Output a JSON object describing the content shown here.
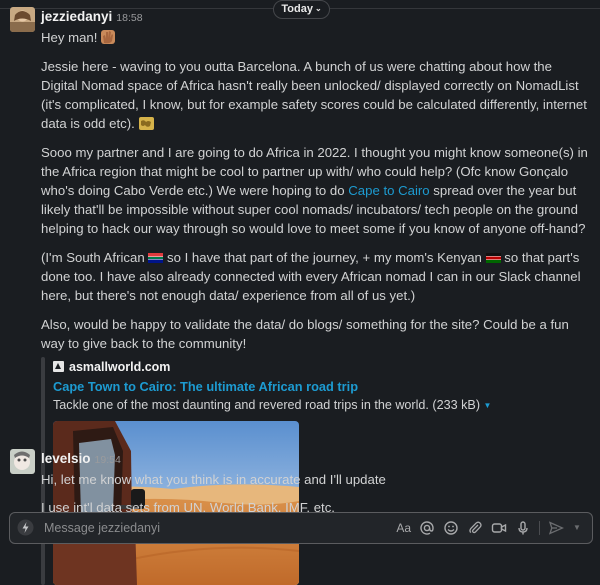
{
  "day_divider": {
    "label": "Today",
    "chevron": "chevron-down-icon"
  },
  "messages": [
    {
      "author": "jezziedanyi",
      "time": "18:58",
      "greeting": "Hey man!",
      "p1": "Jessie here - waving to you outta Barcelona. A bunch of us were chatting about how the Digital Nomad space of Africa hasn't really been unlocked/ displayed correctly on NomadList (it's complicated, I know, but for example safety scores could be calculated differently, internet data is odd etc).",
      "p2_a": "Sooo my partner and I are going to do Africa in 2022. I thought you might know someone(s) in the Africa region that might be cool to partner up with/ who could help? (Ofc know Gonçalo who's doing Cabo Verde etc.) We were hoping to do ",
      "p2_link": "Cape to Cairo",
      "p2_b": " spread over the year but likely that'll be impossible without super cool nomads/ incubators/ tech people on the ground helping to hack our way through so would love to meet some if you know of anyone off-hand?",
      "p3_a": "(I'm South African ",
      "p3_b": " so I have that part of the journey, + my mom's Kenyan ",
      "p3_c": " so that part's done too. I have also already connected with every African nomad I can in our Slack channel here, but there's not enough data/ experience from all of us yet.)",
      "p4": "Also, would be happy to validate the data/ do blogs/ something for the site? Could be a fun way to give back to the community!",
      "unfurl": {
        "site": "asmallworld.com",
        "title": "Cape Town to Cairo: The ultimate African road trip",
        "description": "Tackle one of the most daunting and revered road trips in the world. (233 kB)"
      }
    },
    {
      "author": "levelsio",
      "time": "19:54",
      "line1": "Hi, let me know what you think is in accurate and I'll update",
      "line2": "I use int'l data sets from UN, World Bank, IMF, etc."
    }
  ],
  "composer": {
    "placeholder": "Message jezziedanyi",
    "format_label": "Aa",
    "icons": [
      "lightning-icon",
      "format-icon",
      "at-icon",
      "emoji-icon",
      "attach-icon",
      "video-icon",
      "microphone-icon",
      "send-icon",
      "chevron-down-icon"
    ]
  },
  "colors": {
    "background": "#1a1d21",
    "link": "#1d9bd1",
    "text": "#d1d2d3"
  }
}
